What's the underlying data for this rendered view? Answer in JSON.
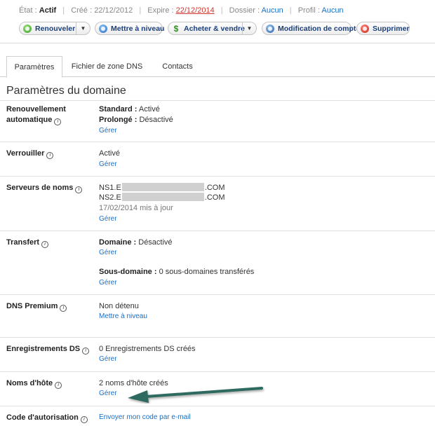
{
  "status": {
    "etat_label": "État :",
    "etat_value": "Actif",
    "cree_label": "Créé :",
    "cree_value": "22/12/2012",
    "expire_label": "Expire :",
    "expire_value": "22/12/2014",
    "dossier_label": "Dossier :",
    "dossier_value": "Aucun",
    "profil_label": "Profil :",
    "profil_value": "Aucun",
    "separator": "|"
  },
  "actions": [
    {
      "label": "Renouveler",
      "icon": "renew-icon",
      "color": "#3e9e2a"
    },
    {
      "label": "Mettre à niveau",
      "icon": "upgrade-icon",
      "color": "#2a6ec7"
    },
    {
      "label": "Acheter & vendre",
      "icon": "dollar-icon",
      "color": "#2f8f1e"
    },
    {
      "label": "Modification de compte",
      "icon": "user-icon",
      "color": "#2b5fa8"
    },
    {
      "label": "Supprimer",
      "icon": "delete-icon",
      "color": "#c8251a"
    }
  ],
  "caret": "▼",
  "tabs": [
    {
      "label": "Paramètres",
      "active": true
    },
    {
      "label": "Fichier de zone DNS",
      "active": false
    },
    {
      "label": "Contacts",
      "active": false
    }
  ],
  "section_title": "Paramètres du domaine",
  "info_glyph": "i",
  "rows": {
    "renew": {
      "label_line1": "Renouvellement",
      "label_line2": "automatique",
      "standard_label": "Standard :",
      "standard_value": "Activé",
      "prolonge_label": "Prolongé :",
      "prolonge_value": "Désactivé",
      "link": "Gérer"
    },
    "lock": {
      "label": "Verrouiller",
      "value": "Activé",
      "link": "Gérer"
    },
    "ns": {
      "label": "Serveurs de noms",
      "ns1_prefix": "NS1.E",
      "ns1_suffix": ".COM",
      "ns2_prefix": "NS2.E",
      "ns2_suffix": ".COM",
      "updated": "17/02/2014 mis à jour",
      "link": "Gérer"
    },
    "transfer": {
      "label": "Transfert",
      "domaine_label": "Domaine :",
      "domaine_value": "Désactivé",
      "link1": "Gérer",
      "sous_label": "Sous-domaine :",
      "sous_value": "0 sous-domaines transférés",
      "link2": "Gérer"
    },
    "dns_premium": {
      "label": "DNS Premium",
      "value": "Non détenu",
      "link": "Mettre à niveau"
    },
    "ds": {
      "label": "Enregistrements DS",
      "value": "0 Enregistrements DS créés",
      "link": "Gérer"
    },
    "hosts": {
      "label": "Noms d'hôte",
      "value": "2 noms d'hôte créés",
      "link": "Gérer"
    },
    "auth": {
      "label": "Code d'autorisation",
      "link": "Envoyer mon code par e-mail"
    }
  },
  "arrow_color": "#2f6b5e"
}
